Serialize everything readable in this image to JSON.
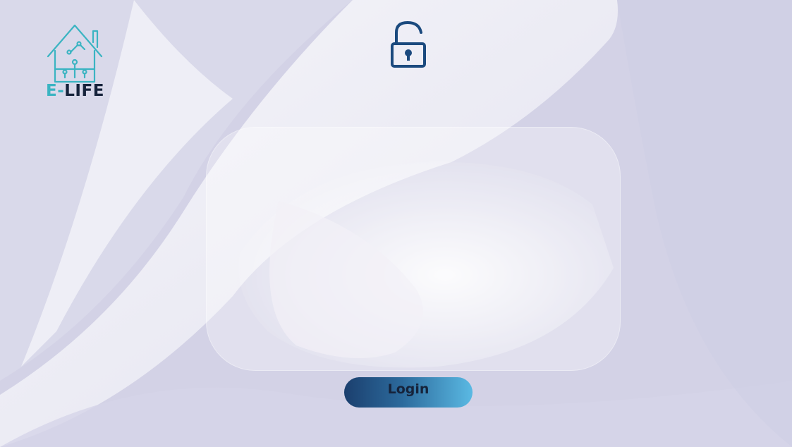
{
  "brand": {
    "name_prefix": "E-",
    "name_suffix": "LIFE",
    "logo_icon": "smart-home-icon",
    "colors": {
      "teal": "#3bb4c2",
      "navy": "#16233b"
    }
  },
  "header": {
    "status_icon": "unlocked-padlock-icon"
  },
  "form": {
    "card_color": "#ffffff"
  },
  "login_button": {
    "label": "Login",
    "gradient_start": "#1b3f6e",
    "gradient_end": "#5ab9e3"
  },
  "background": {
    "base_color": "#d3d2e6",
    "accent_color": "#ffffff"
  }
}
